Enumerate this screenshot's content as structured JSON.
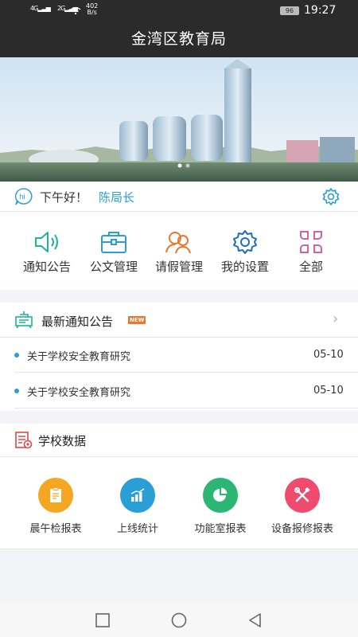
{
  "status": {
    "sig1": "4G",
    "sig2": "2G",
    "net_speed": "402",
    "net_unit": "B/s",
    "battery": "96",
    "time": "19:27"
  },
  "app": {
    "title": "金湾区教育局"
  },
  "greeting": {
    "hello": "下午好！",
    "user": "陈局长"
  },
  "quick_actions": [
    {
      "label": "通知公告",
      "icon": "speaker-icon",
      "color": "#1fb39a"
    },
    {
      "label": "公文管理",
      "icon": "briefcase-icon",
      "color": "#2a9fd6"
    },
    {
      "label": "请假管理",
      "icon": "people-icon",
      "color": "#e8762d"
    },
    {
      "label": "我的设置",
      "icon": "gear-icon",
      "color": "#1e6fb8"
    },
    {
      "label": "全部",
      "icon": "grid-icon",
      "color": "#d9619e"
    }
  ],
  "notices": {
    "title": "最新通知公告",
    "badge": "NEW",
    "items": [
      {
        "text": "关于学校安全教育研究",
        "date": "05-10"
      },
      {
        "text": "关于学校安全教育研究",
        "date": "05-10"
      }
    ]
  },
  "school": {
    "title": "学校数据",
    "items": [
      {
        "label": "晨午检报表",
        "icon": "clipboard-icon",
        "color": "#f5a623"
      },
      {
        "label": "上线统计",
        "icon": "bar-chart-icon",
        "color": "#2a9fd6"
      },
      {
        "label": "功能室报表",
        "icon": "pie-chart-icon",
        "color": "#2bb673"
      },
      {
        "label": "设备报修报表",
        "icon": "tools-icon",
        "color": "#ee4b6e"
      }
    ]
  },
  "colors": {
    "header": "#2b2b2b",
    "accent": "#2a9fd6",
    "background": "#f3f4f8"
  }
}
